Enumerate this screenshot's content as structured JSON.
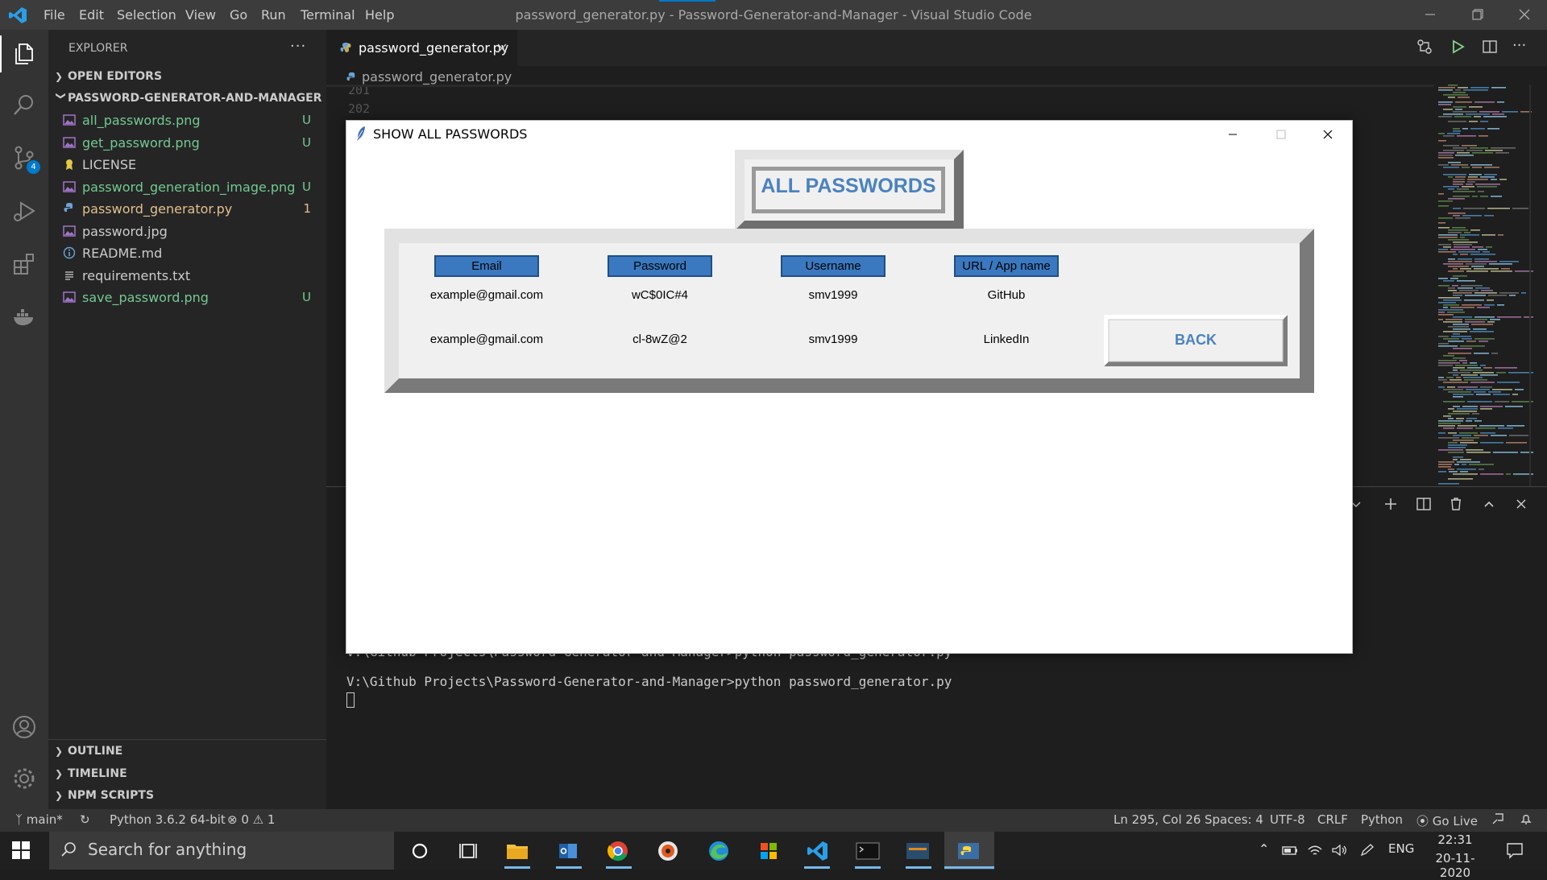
{
  "colors": {
    "accent": "#007acc",
    "untracked": "#73c991",
    "modified": "#e2c08d",
    "tk_blue": "#3a79c0",
    "tk_text_blue": "#4a82c0"
  },
  "menu": [
    "File",
    "Edit",
    "Selection",
    "View",
    "Go",
    "Run",
    "Terminal",
    "Help"
  ],
  "window_title": "password_generator.py - Password-Generator-and-Manager - Visual Studio Code",
  "activity_badge": "4",
  "sidebar": {
    "title": "EXPLORER",
    "more": "···",
    "open_editors": "OPEN EDITORS",
    "project": "PASSWORD-GENERATOR-AND-MANAGER",
    "files": [
      {
        "name": "all_passwords.png",
        "icon": "image-icon",
        "badge": "U",
        "status": "untracked"
      },
      {
        "name": "get_password.png",
        "icon": "image-icon",
        "badge": "U",
        "status": "untracked"
      },
      {
        "name": "LICENSE",
        "icon": "license-icon",
        "badge": "",
        "status": "normal"
      },
      {
        "name": "password_generation_image.png",
        "icon": "image-icon",
        "badge": "U",
        "status": "untracked"
      },
      {
        "name": "password_generator.py",
        "icon": "python-icon",
        "badge": "1",
        "status": "modified"
      },
      {
        "name": "password.jpg",
        "icon": "image-icon",
        "badge": "",
        "status": "normal"
      },
      {
        "name": "README.md",
        "icon": "info-icon",
        "badge": "",
        "status": "normal"
      },
      {
        "name": "requirements.txt",
        "icon": "text-file-icon",
        "badge": "",
        "status": "normal"
      },
      {
        "name": "save_password.png",
        "icon": "image-icon",
        "badge": "U",
        "status": "untracked"
      }
    ],
    "outline": "OUTLINE",
    "timeline": "TIMELINE",
    "npm": "NPM SCRIPTS"
  },
  "editor": {
    "tab": "password_generator.py",
    "breadcrumb": "password_generator.py",
    "lines": [
      "201",
      "202"
    ]
  },
  "terminal": {
    "ghost": "V:\\Github Projects\\Password-Generator-and-Manager>python password_generator.py",
    "line": "V:\\Github Projects\\Password-Generator-and-Manager>python password_generator.py"
  },
  "statusbar": {
    "branch": "main*",
    "python": "Python 3.6.2 64-bit",
    "errors": "0",
    "warnings": "1",
    "position": "Ln 295, Col 26",
    "spaces": "Spaces: 4",
    "encoding": "UTF-8",
    "eol": "CRLF",
    "language": "Python",
    "golive": "Go Live"
  },
  "taskbar": {
    "search_placeholder": "Search for anything",
    "lang": "ENG",
    "time": "22:31",
    "date": "20-11-2020"
  },
  "tk": {
    "title": "SHOW ALL PASSWORDS",
    "heading": "ALL PASSWORDS",
    "columns": [
      "Email",
      "Password",
      "Username",
      "URL / App name"
    ],
    "rows": [
      [
        "example@gmail.com",
        "wC$0IC#4",
        "smv1999",
        "GitHub"
      ],
      [
        "example@gmail.com",
        "cl-8wZ@2",
        "smv1999",
        "LinkedIn"
      ]
    ],
    "back": "BACK"
  }
}
